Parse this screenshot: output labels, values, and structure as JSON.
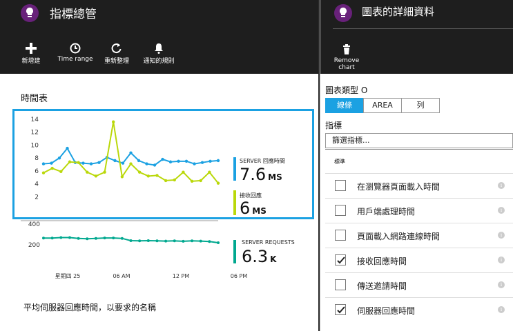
{
  "left_blade": {
    "title": "指標總管",
    "toolbar": [
      {
        "label": "新增建",
        "icon": "plus-icon"
      },
      {
        "label": "Time range",
        "icon": "clock-icon"
      },
      {
        "label": "重新整理",
        "icon": "refresh-icon"
      },
      {
        "label": "通知的規則",
        "icon": "bell-icon"
      }
    ],
    "section_label": "時間表",
    "footer_caption": "平均伺服器回應時間，以要求的名稱"
  },
  "right_blade": {
    "title": "圖表的詳細資料",
    "remove_label": "Remove chart",
    "chart_type_label": "圖表類型 O",
    "chart_types": [
      "線條",
      "AREA",
      "列"
    ],
    "selected_chart_type": "線條",
    "metrics_label": "指標",
    "filter_placeholder": "篩選指標...",
    "metrics_group_label": "標準",
    "metrics": [
      {
        "name": "在瀏覽器頁面載入時間",
        "checked": false
      },
      {
        "name": "用戶端處理時間",
        "checked": false
      },
      {
        "name": "頁面載入網路連線時間",
        "checked": false
      },
      {
        "name": "接收回應時間",
        "checked": true
      },
      {
        "name": "傳送邀請時間",
        "checked": false
      },
      {
        "name": "伺服器回應時間",
        "checked": true
      }
    ]
  },
  "colors": {
    "accent": "#1ba1e2",
    "server_response": "#1ba1e2",
    "receive_response": "#bad80a",
    "server_requests": "#00a88f",
    "header_bg": "#1e1e1e",
    "app_icon": "#68217a"
  },
  "chart_data": [
    {
      "type": "line",
      "x_ticks": [
        "星期四 25",
        "06 AM",
        "12 PM",
        "06 PM"
      ],
      "ylim": [
        0,
        14
      ],
      "y_ticks": [
        "14",
        "12",
        "10",
        "8",
        "6",
        "4",
        "2"
      ],
      "series": [
        {
          "name": "SERVER 回應時間",
          "summary_value": "7.6",
          "unit": "MS",
          "values": [
            7.1,
            7.2,
            8.0,
            9.5,
            7.3,
            7.2,
            7.1,
            7.3,
            8.1,
            7.6,
            7.2,
            8.8,
            7.6,
            7.1,
            6.9,
            7.8,
            7.4,
            7.5,
            7.5,
            7.1,
            7.3,
            7.5,
            7.6
          ]
        },
        {
          "name": "接收回應",
          "summary_value": "6",
          "unit": "MS",
          "values": [
            5.7,
            6.4,
            5.9,
            7.4,
            7.3,
            5.8,
            5.2,
            5.8,
            13.6,
            5.1,
            7.1,
            5.8,
            5.2,
            5.3,
            4.5,
            4.6,
            5.8,
            4.4,
            4.5,
            5.8,
            4.1
          ]
        }
      ]
    },
    {
      "type": "line",
      "x_ticks": [
        "星期四 25",
        "06 AM",
        "12 PM",
        "06 PM"
      ],
      "ylim": [
        0,
        400
      ],
      "y_ticks": [
        "400",
        "200"
      ],
      "series": [
        {
          "name": "SERVER REQUESTS",
          "summary_value": "6.3",
          "unit": "K",
          "values": [
            265,
            265,
            270,
            270,
            262,
            258,
            262,
            266,
            266,
            262,
            240,
            238,
            240,
            238,
            236,
            238,
            234,
            238,
            236,
            232,
            220
          ]
        }
      ]
    }
  ]
}
